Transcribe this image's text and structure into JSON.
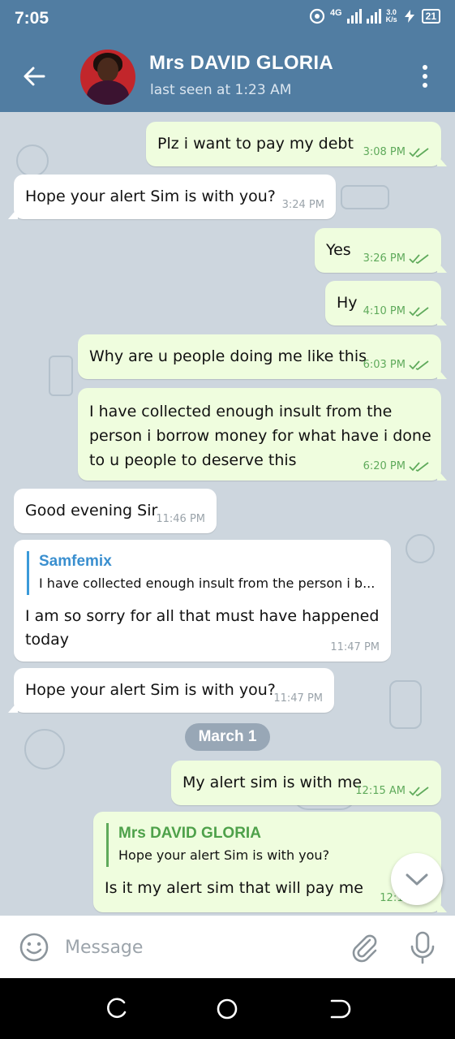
{
  "status_bar": {
    "time": "7:05",
    "network": "4G",
    "speed_value": "3.0",
    "speed_unit": "K/s",
    "battery": "21"
  },
  "header": {
    "contact_name": "Mrs DAVID GLORIA",
    "last_seen": "last seen at 1:23 AM"
  },
  "messages": [
    {
      "dir": "out",
      "lines": [
        "Plz i want to pay my debt"
      ],
      "time": "3:08 PM"
    },
    {
      "dir": "in",
      "lines": [
        "Hope your alert Sim is with you?"
      ],
      "time": "3:24 PM"
    },
    {
      "dir": "out",
      "lines": [
        "Yes"
      ],
      "time": "3:26 PM"
    },
    {
      "dir": "out",
      "lines": [
        "Hy"
      ],
      "time": "4:10 PM"
    },
    {
      "dir": "out",
      "lines": [
        "Why are u people doing me like this"
      ],
      "time": "6:03 PM"
    },
    {
      "dir": "out",
      "lines": [
        "I have collected enough insult from the",
        "person i borrow money for what have i done",
        "to u people to deserve this"
      ],
      "time": "6:20 PM"
    },
    {
      "dir": "in",
      "lines": [
        "Good evening Sir"
      ],
      "time": "11:46 PM"
    },
    {
      "dir": "in",
      "reply_name": "Samfemix",
      "reply_text": "I have collected enough insult from the person i b...",
      "lines": [
        "I am so sorry for all that must have happened",
        "today"
      ],
      "time": "11:47 PM"
    },
    {
      "dir": "in",
      "lines": [
        "Hope your alert Sim is with you?"
      ],
      "time": "11:47 PM"
    },
    {
      "dir": "out",
      "lines": [
        "My alert sim is with me"
      ],
      "time": "12:15 AM"
    },
    {
      "dir": "out",
      "reply_name": "Mrs DAVID GLORIA",
      "reply_text": "Hope your alert Sim is with you?",
      "lines": [
        "Is it my alert sim that will pay me"
      ],
      "time": "12:16 AM"
    }
  ],
  "date_separator": "March 1",
  "composer": {
    "placeholder": "Message"
  },
  "icons": {
    "back": "arrow-left-icon",
    "menu": "more-vertical-icon",
    "emoji": "smiley-icon",
    "attach": "paperclip-icon",
    "mic": "microphone-icon",
    "scroll": "chevron-down-icon"
  },
  "colors": {
    "header": "#517da2",
    "outgoing_bubble": "#effdde",
    "incoming_bubble": "#ffffff",
    "check": "#5faa5b",
    "reply_accent_in": "#3a9ad9",
    "reply_accent_out": "#5faa5b"
  }
}
